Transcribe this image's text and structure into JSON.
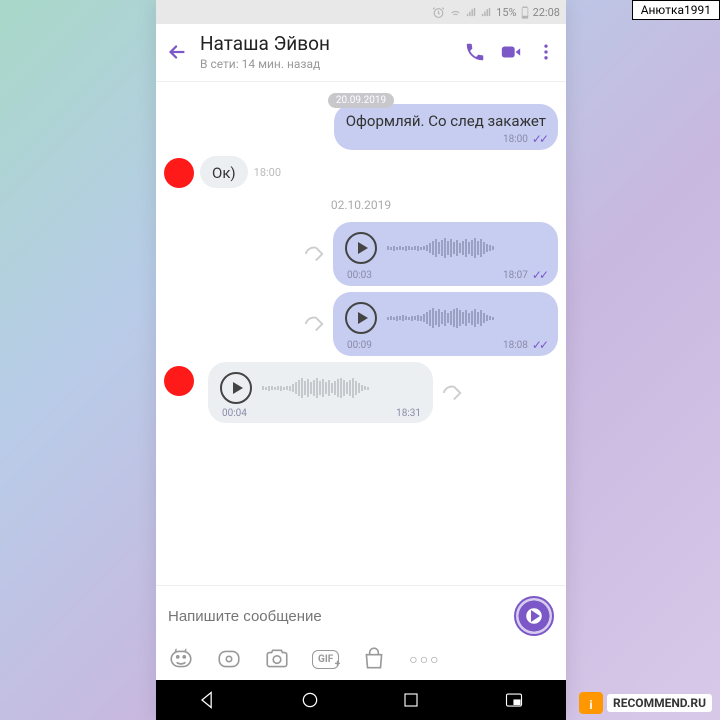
{
  "overlay": {
    "username": "Анютка1991",
    "watermark": "RECOMMEND.RU",
    "watermark_badge": "i"
  },
  "statusbar": {
    "battery": "15%",
    "time": "22:08"
  },
  "header": {
    "name": "Наташа Эйвон",
    "status": "В сети: 14 мин. назад"
  },
  "chat": {
    "date1": "20.09.2019",
    "msg_out1": {
      "text": "Оформляй. Со след закажет",
      "time": "18:00"
    },
    "msg_in1": {
      "text": "Ок)",
      "time": "18:00"
    },
    "date2": "02.10.2019",
    "voice_out1": {
      "duration": "00:03",
      "time": "18:07"
    },
    "voice_out2": {
      "duration": "00:09",
      "time": "18:08"
    },
    "voice_in1": {
      "duration": "00:04",
      "time": "18:31"
    }
  },
  "composer": {
    "placeholder": "Напишите сообщение",
    "gif_label": "GIF"
  }
}
